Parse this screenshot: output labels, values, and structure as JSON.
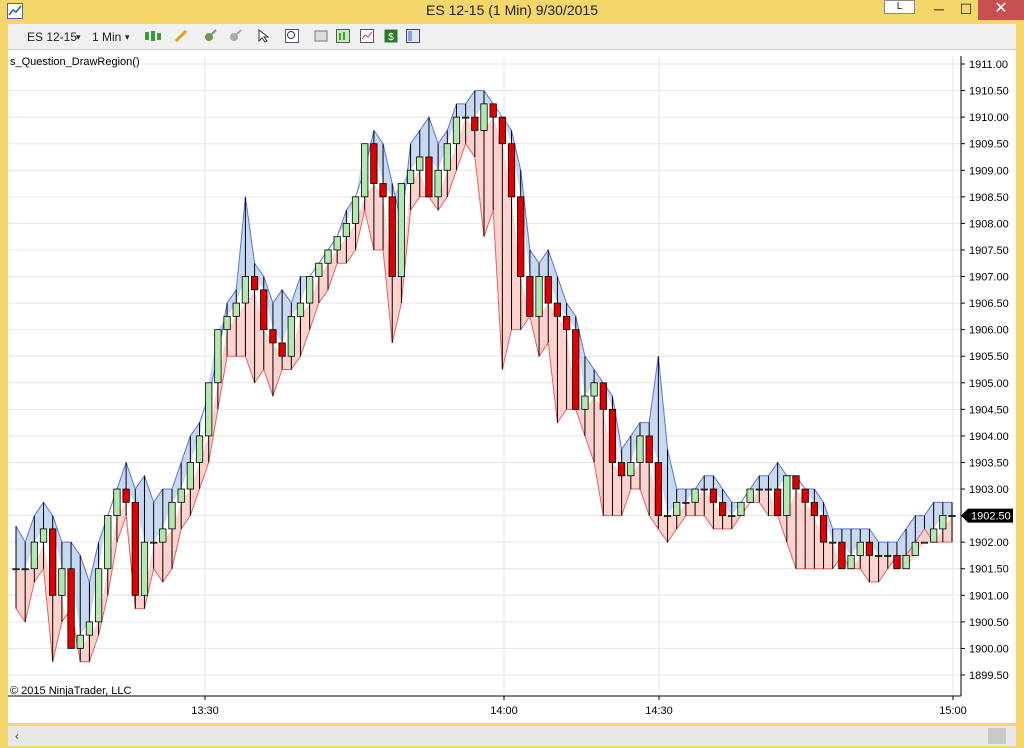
{
  "window": {
    "title": "ES 12-15 (1 Min)  9/30/2015",
    "button_l": "L",
    "min_glyph": "─",
    "max_glyph": "☐",
    "close_glyph": "✕"
  },
  "toolbar": {
    "instrument": "ES 12-15",
    "interval": "1 Min",
    "dropdown_glyph": "▾"
  },
  "chart": {
    "strategy_label": "s_Question_DrawRegion()",
    "copyright": "© 2015 NinjaTrader, LLC"
  },
  "scrollbar": {
    "left_glyph": "‹"
  },
  "colors": {
    "up_bar": "#b5e7b0",
    "down_bar": "#e00000",
    "upper_region": "#c9d8f1",
    "lower_region": "#fbd2cd",
    "upper_line": "#5b74d6",
    "lower_line": "#e86060",
    "grid": "#e4e4e4"
  },
  "chart_data": {
    "type": "candlestick",
    "instrument": "ES 12-15",
    "interval": "1 Min",
    "ylim": [
      1899.5,
      1911.0
    ],
    "y_ticks": [
      "1911.00",
      "1910.50",
      "1910.00",
      "1909.50",
      "1909.00",
      "1908.50",
      "1908.00",
      "1907.50",
      "1907.00",
      "1906.50",
      "1906.00",
      "1905.50",
      "1905.00",
      "1904.50",
      "1904.00",
      "1903.50",
      "1903.00",
      "1902.50",
      "1902.00",
      "1901.50",
      "1901.00",
      "1900.50",
      "1900.00",
      "1899.50"
    ],
    "x_ticks": [
      "13:30",
      "14:00",
      "14:30",
      "15:00"
    ],
    "last_price": "1902.50",
    "series": [
      {
        "name": "OHLC",
        "o": [
          1901.5,
          1901.5,
          1901.5,
          1902.0,
          1902.25,
          1901.0,
          1901.5,
          1900.0,
          1900.25,
          1900.5,
          1901.5,
          1902.5,
          1903.0,
          1902.75,
          1901.0,
          1902.0,
          1902.0,
          1902.25,
          1902.75,
          1903.0,
          1903.5,
          1904.0,
          1905.0,
          1906.0,
          1906.25,
          1906.5,
          1907.0,
          1906.75,
          1906.0,
          1905.75,
          1905.5,
          1906.25,
          1906.5,
          1907.0,
          1907.25,
          1907.5,
          1907.75,
          1908.0,
          1908.5,
          1909.5,
          1908.75,
          1908.5,
          1907.0,
          1908.75,
          1909.0,
          1909.25,
          1908.5,
          1909.0,
          1909.5,
          1910.0,
          1910.0,
          1909.75,
          1910.25,
          1910.0,
          1909.5,
          1908.5,
          1907.0,
          1906.25,
          1907.0,
          1906.5,
          1906.25,
          1906.0,
          1904.5,
          1904.75,
          1905.0,
          1904.5,
          1903.5,
          1903.25,
          1903.5,
          1904.0,
          1903.5,
          1902.5,
          1902.5,
          1902.75,
          1902.75,
          1903.0,
          1903.0,
          1902.75,
          1902.5,
          1902.5,
          1902.75,
          1903.0,
          1903.0,
          1903.0,
          1902.5,
          1903.25,
          1903.0,
          1902.75,
          1902.5,
          1902.0,
          1902.0,
          1901.5,
          1901.75,
          1902.0,
          1901.75,
          1901.75,
          1901.75,
          1901.5,
          1901.75,
          1902.0,
          1902.0,
          1902.25,
          1902.5
        ],
        "h": [
          1902.3,
          1902.0,
          1902.5,
          1902.75,
          1902.5,
          1902.0,
          1902.0,
          1901.75,
          1901.25,
          1902.0,
          1902.5,
          1903.0,
          1903.5,
          1903.0,
          1903.25,
          1902.75,
          1903.0,
          1903.0,
          1903.5,
          1904.0,
          1904.25,
          1904.75,
          1905.5,
          1906.5,
          1906.75,
          1908.5,
          1907.25,
          1907.0,
          1906.5,
          1906.75,
          1906.5,
          1907.0,
          1907.0,
          1907.25,
          1907.5,
          1907.75,
          1908.25,
          1908.5,
          1909.0,
          1909.75,
          1909.5,
          1908.75,
          1908.0,
          1909.5,
          1909.75,
          1910.0,
          1909.5,
          1909.75,
          1910.25,
          1910.25,
          1910.5,
          1910.5,
          1910.25,
          1910.0,
          1909.75,
          1909.0,
          1907.5,
          1907.25,
          1907.5,
          1907.0,
          1906.5,
          1906.25,
          1905.5,
          1905.25,
          1905.0,
          1904.75,
          1903.75,
          1904.0,
          1904.25,
          1904.25,
          1905.5,
          1903.75,
          1903.0,
          1903.0,
          1903.0,
          1903.25,
          1903.25,
          1903.0,
          1902.75,
          1902.75,
          1903.0,
          1903.25,
          1903.25,
          1903.5,
          1903.25,
          1903.25,
          1903.0,
          1903.0,
          1902.75,
          1902.25,
          1902.25,
          1902.25,
          1902.25,
          1902.25,
          1902.0,
          1902.0,
          1902.0,
          1902.25,
          1902.5,
          1902.5,
          1902.75,
          1902.75,
          1902.75
        ],
        "l": [
          1900.75,
          1900.5,
          1901.25,
          1901.5,
          1899.75,
          1900.5,
          1900.75,
          1899.75,
          1899.75,
          1900.25,
          1901.0,
          1902.0,
          1902.5,
          1900.75,
          1900.75,
          1901.5,
          1901.25,
          1901.5,
          1902.25,
          1902.5,
          1903.0,
          1903.5,
          1904.5,
          1905.5,
          1905.5,
          1905.5,
          1905.0,
          1905.25,
          1904.75,
          1905.25,
          1905.25,
          1905.5,
          1906.0,
          1906.5,
          1906.75,
          1907.25,
          1907.25,
          1907.5,
          1908.25,
          1907.5,
          1907.5,
          1905.75,
          1906.5,
          1908.25,
          1908.5,
          1908.5,
          1908.25,
          1908.5,
          1909.0,
          1909.5,
          1909.25,
          1907.75,
          1908.25,
          1905.25,
          1906.0,
          1906.0,
          1906.25,
          1905.5,
          1905.75,
          1904.25,
          1904.5,
          1904.5,
          1904.0,
          1903.5,
          1902.5,
          1902.5,
          1902.5,
          1903.0,
          1903.0,
          1902.5,
          1902.25,
          1902.0,
          1902.25,
          1902.5,
          1902.5,
          1902.5,
          1902.25,
          1902.25,
          1902.25,
          1902.5,
          1902.75,
          1902.75,
          1902.5,
          1902.5,
          1902.0,
          1901.5,
          1901.5,
          1901.5,
          1901.5,
          1901.5,
          1901.75,
          1901.5,
          1901.5,
          1901.25,
          1901.25,
          1901.5,
          1901.75,
          1901.75,
          1902.0,
          1902.25,
          1902.0,
          1902.0,
          1902.0
        ],
        "c": [
          1901.5,
          1901.5,
          1902.0,
          1902.25,
          1901.0,
          1901.5,
          1900.0,
          1900.25,
          1900.5,
          1901.5,
          1902.5,
          1903.0,
          1902.75,
          1901.0,
          1902.0,
          1902.0,
          1902.25,
          1902.75,
          1903.0,
          1903.5,
          1904.0,
          1905.0,
          1906.0,
          1906.25,
          1906.5,
          1907.0,
          1906.75,
          1906.0,
          1905.75,
          1905.5,
          1906.25,
          1906.5,
          1907.0,
          1907.25,
          1907.5,
          1907.75,
          1908.0,
          1908.5,
          1909.5,
          1908.75,
          1908.5,
          1907.0,
          1908.75,
          1909.0,
          1909.25,
          1908.5,
          1909.0,
          1909.5,
          1910.0,
          1910.0,
          1909.75,
          1910.25,
          1910.0,
          1909.5,
          1908.5,
          1907.0,
          1906.25,
          1907.0,
          1906.5,
          1906.25,
          1906.0,
          1904.5,
          1904.75,
          1905.0,
          1904.5,
          1903.5,
          1903.25,
          1903.5,
          1904.0,
          1903.5,
          1902.5,
          1902.5,
          1902.75,
          1902.75,
          1903.0,
          1903.0,
          1902.75,
          1902.5,
          1902.5,
          1902.75,
          1903.0,
          1903.0,
          1903.0,
          1902.5,
          1903.25,
          1903.0,
          1902.75,
          1902.5,
          1902.0,
          1902.0,
          1901.5,
          1901.75,
          1902.0,
          1901.75,
          1901.75,
          1901.75,
          1901.5,
          1901.75,
          1902.0,
          1902.0,
          1902.25,
          1902.5,
          1902.5
        ]
      }
    ]
  }
}
